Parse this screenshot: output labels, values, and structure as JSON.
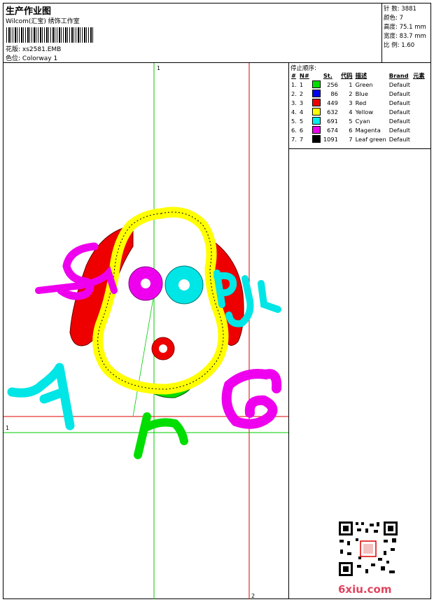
{
  "header": {
    "title": "生产作业图",
    "subtitle": "Wilcom(汇宝) 绣饰工作室",
    "design_label": "花版:",
    "design_file": "xs2581.EMB",
    "color_label": "色位:",
    "colorway": "Colorway 1"
  },
  "specs": [
    {
      "label": "针 数:",
      "value": "3881"
    },
    {
      "label": "颜色:",
      "value": "7"
    },
    {
      "label": "高度:",
      "value": "75.1 mm"
    },
    {
      "label": "宽度:",
      "value": "83.7 mm"
    },
    {
      "label": "比 例:",
      "value": "1.60"
    }
  ],
  "stop_sequence": {
    "heading": "停止顺序:",
    "columns": [
      "#",
      "N#",
      "St.",
      "代码",
      "描述",
      "Brand",
      "元素"
    ],
    "rows": [
      {
        "idx": "1.",
        "n": "1",
        "color": "#00dd00",
        "stitches": "256",
        "code": "1",
        "desc": "Green",
        "brand": "Default"
      },
      {
        "idx": "2.",
        "n": "2",
        "color": "#0000ee",
        "stitches": "86",
        "code": "2",
        "desc": "Blue",
        "brand": "Default"
      },
      {
        "idx": "3.",
        "n": "3",
        "color": "#ee0000",
        "stitches": "449",
        "code": "3",
        "desc": "Red",
        "brand": "Default"
      },
      {
        "idx": "4.",
        "n": "4",
        "color": "#ffff00",
        "stitches": "632",
        "code": "4",
        "desc": "Yellow",
        "brand": "Default"
      },
      {
        "idx": "5.",
        "n": "5",
        "color": "#00eeee",
        "stitches": "691",
        "code": "5",
        "desc": "Cyan",
        "brand": "Default"
      },
      {
        "idx": "6.",
        "n": "6",
        "color": "#ee00ee",
        "stitches": "674",
        "code": "6",
        "desc": "Magenta",
        "brand": "Default"
      },
      {
        "idx": "7.",
        "n": "7",
        "color": "#000000",
        "stitches": "1091",
        "code": "7",
        "desc": "Leaf green",
        "brand": "Default"
      }
    ]
  },
  "guides": {
    "v1": "1",
    "v2": "2",
    "h1": "1"
  },
  "watermark": {
    "site": "6xiu.com"
  },
  "colors": {
    "red": "#ee0000",
    "green": "#00dd00",
    "yellow": "#ffff00",
    "cyan": "#00e5e5",
    "magenta": "#ee00ee"
  }
}
